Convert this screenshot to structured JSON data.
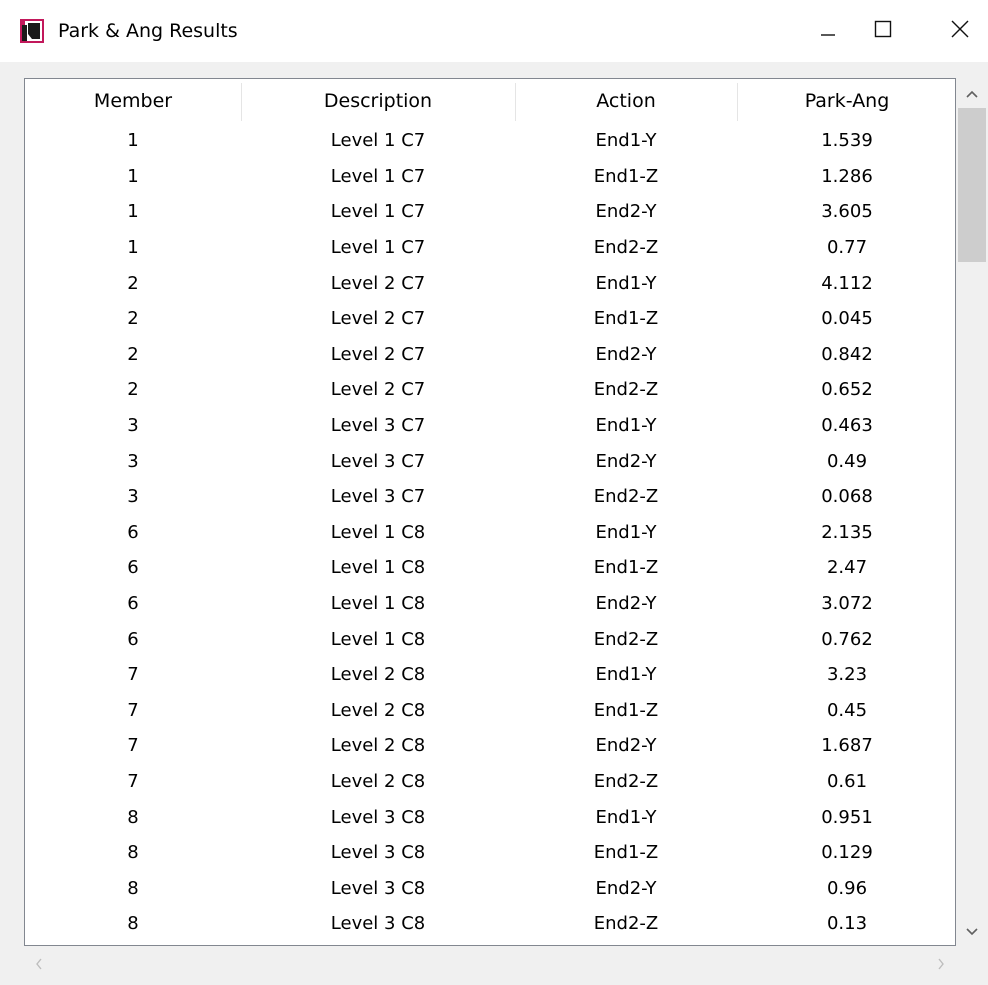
{
  "window": {
    "title": "Park & Ang Results",
    "accent_color": "#c2185b"
  },
  "table": {
    "columns": [
      "Member",
      "Description",
      "Action",
      "Park-Ang"
    ],
    "rows": [
      [
        "1",
        "Level 1 C7",
        "End1-Y",
        "1.539"
      ],
      [
        "1",
        "Level 1 C7",
        "End1-Z",
        "1.286"
      ],
      [
        "1",
        "Level 1 C7",
        "End2-Y",
        "3.605"
      ],
      [
        "1",
        "Level 1 C7",
        "End2-Z",
        "0.77"
      ],
      [
        "2",
        "Level 2 C7",
        "End1-Y",
        "4.112"
      ],
      [
        "2",
        "Level 2 C7",
        "End1-Z",
        "0.045"
      ],
      [
        "2",
        "Level 2 C7",
        "End2-Y",
        "0.842"
      ],
      [
        "2",
        "Level 2 C7",
        "End2-Z",
        "0.652"
      ],
      [
        "3",
        "Level 3 C7",
        "End1-Y",
        "0.463"
      ],
      [
        "3",
        "Level 3 C7",
        "End2-Y",
        "0.49"
      ],
      [
        "3",
        "Level 3 C7",
        "End2-Z",
        "0.068"
      ],
      [
        "6",
        "Level 1 C8",
        "End1-Y",
        "2.135"
      ],
      [
        "6",
        "Level 1 C8",
        "End1-Z",
        "2.47"
      ],
      [
        "6",
        "Level 1 C8",
        "End2-Y",
        "3.072"
      ],
      [
        "6",
        "Level 1 C8",
        "End2-Z",
        "0.762"
      ],
      [
        "7",
        "Level 2 C8",
        "End1-Y",
        "3.23"
      ],
      [
        "7",
        "Level 2 C8",
        "End1-Z",
        "0.45"
      ],
      [
        "7",
        "Level 2 C8",
        "End2-Y",
        "1.687"
      ],
      [
        "7",
        "Level 2 C8",
        "End2-Z",
        "0.61"
      ],
      [
        "8",
        "Level 3 C8",
        "End1-Y",
        "0.951"
      ],
      [
        "8",
        "Level 3 C8",
        "End1-Z",
        "0.129"
      ],
      [
        "8",
        "Level 3 C8",
        "End2-Y",
        "0.96"
      ],
      [
        "8",
        "Level 3 C8",
        "End2-Z",
        "0.13"
      ]
    ]
  },
  "icons": {
    "app": "app-icon",
    "minimize": "minimize-icon",
    "maximize": "maximize-icon",
    "close": "close-icon",
    "scroll_up": "chevron-up-icon",
    "scroll_down": "chevron-down-icon",
    "scroll_left": "chevron-left-icon",
    "scroll_right": "chevron-right-icon"
  }
}
